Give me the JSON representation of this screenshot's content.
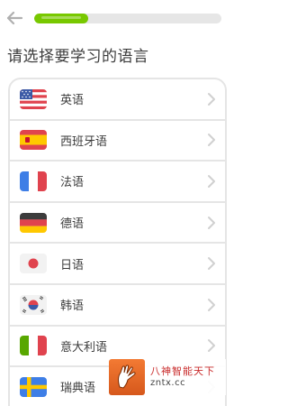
{
  "header": {
    "back_icon": "arrow-left-icon",
    "progress": 0.29,
    "progress_color": "#78c800"
  },
  "title": "请选择要学习的语言",
  "languages": [
    {
      "label": "英语",
      "flag": "us-flag-icon"
    },
    {
      "label": "西班牙语",
      "flag": "spain-flag-icon"
    },
    {
      "label": "法语",
      "flag": "france-flag-icon"
    },
    {
      "label": "德语",
      "flag": "germany-flag-icon"
    },
    {
      "label": "日语",
      "flag": "japan-flag-icon"
    },
    {
      "label": "韩语",
      "flag": "korea-flag-icon"
    },
    {
      "label": "意大利语",
      "flag": "italy-flag-icon"
    },
    {
      "label": "瑞典语",
      "flag": "sweden-flag-icon"
    }
  ],
  "watermark": {
    "title": "八神智能天下",
    "url": "zntx.cc"
  }
}
